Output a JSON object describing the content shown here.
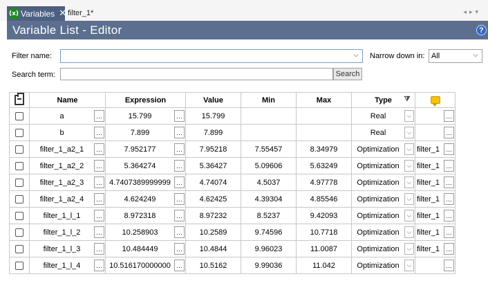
{
  "tabs": [
    {
      "label": "Variables",
      "icon": "variables-icon",
      "active": true
    },
    {
      "label": "filter_1*",
      "active": false
    }
  ],
  "title": "Variable List - Editor",
  "filter": {
    "name_label": "Filter name:",
    "name_value": "",
    "narrow_label": "Narrow down in:",
    "narrow_value": "All",
    "search_label": "Search term:",
    "search_value": "",
    "search_button": "Search"
  },
  "columns": {
    "name": "Name",
    "expression": "Expression",
    "value": "Value",
    "min": "Min",
    "max": "Max",
    "type": "Type"
  },
  "rows": [
    {
      "name": "a",
      "expression": "15.799",
      "value": "15.799",
      "min": "",
      "max": "",
      "type": "Real",
      "comment": ""
    },
    {
      "name": "b",
      "expression": "7.899",
      "value": "7.899",
      "min": "",
      "max": "",
      "type": "Real",
      "comment": ""
    },
    {
      "name": "filter_1_a2_1",
      "expression": "7.952177",
      "value": "7.95218",
      "min": "7.55457",
      "max": "8.34979",
      "type": "Optimization",
      "comment": "filter_1"
    },
    {
      "name": "filter_1_a2_2",
      "expression": "5.364274",
      "value": "5.36427",
      "min": "5.09606",
      "max": "5.63249",
      "type": "Optimization",
      "comment": "filter_1"
    },
    {
      "name": "filter_1_a2_3",
      "expression": "4.7407389999999",
      "value": "4.74074",
      "min": "4.5037",
      "max": "4.97778",
      "type": "Optimization",
      "comment": "filter_1"
    },
    {
      "name": "filter_1_a2_4",
      "expression": "4.624249",
      "value": "4.62425",
      "min": "4.39304",
      "max": "4.85546",
      "type": "Optimization",
      "comment": "filter_1"
    },
    {
      "name": "filter_1_l_1",
      "expression": "8.972318",
      "value": "8.97232",
      "min": "8.5237",
      "max": "9.42093",
      "type": "Optimization",
      "comment": "filter_1"
    },
    {
      "name": "filter_1_l_2",
      "expression": "10.258903",
      "value": "10.2589",
      "min": "9.74596",
      "max": "10.7718",
      "type": "Optimization",
      "comment": "filter_1"
    },
    {
      "name": "filter_1_l_3",
      "expression": "10.484449",
      "value": "10.4844",
      "min": "9.96023",
      "max": "11.0087",
      "type": "Optimization",
      "comment": "filter_1"
    },
    {
      "name": "filter_1_l_4",
      "expression": "10.516170000000",
      "value": "10.5162",
      "min": "9.99036",
      "max": "11.042",
      "type": "Optimization",
      "comment": ""
    }
  ]
}
